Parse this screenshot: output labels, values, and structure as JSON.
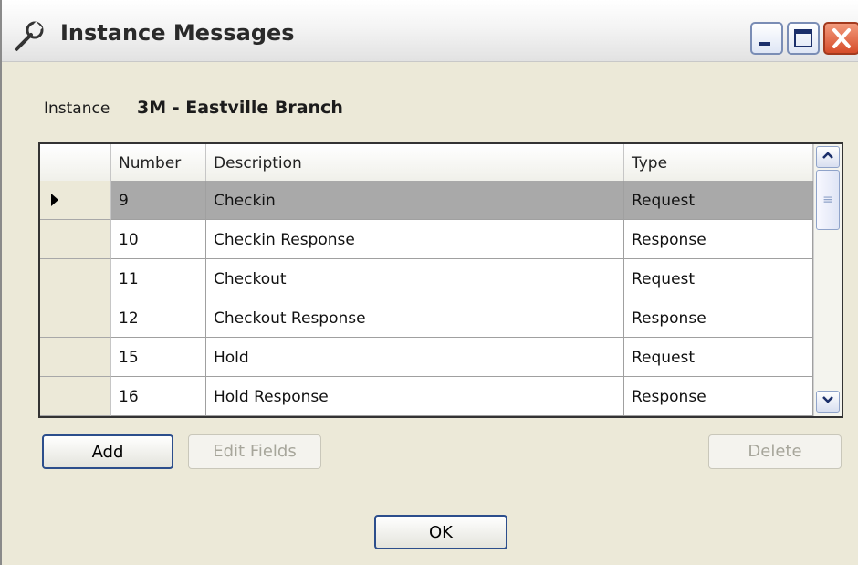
{
  "window": {
    "title": "Instance Messages",
    "icons": {
      "app": "wrench-icon",
      "minimize": "minimize-icon",
      "maximize": "maximize-icon",
      "close": "close-icon"
    }
  },
  "instance": {
    "label": "Instance",
    "value": "3M - Eastville Branch"
  },
  "grid": {
    "columns": [
      "Number",
      "Description",
      "Type"
    ],
    "selected_row": 0,
    "rows": [
      {
        "number": "9",
        "description": "Checkin",
        "type": "Request"
      },
      {
        "number": "10",
        "description": "Checkin Response",
        "type": "Response"
      },
      {
        "number": "11",
        "description": "Checkout",
        "type": "Request"
      },
      {
        "number": "12",
        "description": "Checkout Response",
        "type": "Response"
      },
      {
        "number": "15",
        "description": "Hold",
        "type": "Request"
      },
      {
        "number": "16",
        "description": "Hold Response",
        "type": "Response"
      }
    ]
  },
  "buttons": {
    "add": "Add",
    "edit_fields": "Edit Fields",
    "delete": "Delete",
    "ok": "OK"
  },
  "colors": {
    "dialog_bg": "#ece9d8",
    "selected_row": "#a9a9a9",
    "close_button": "#d64c2a",
    "focus_border": "#2c4e8c"
  }
}
